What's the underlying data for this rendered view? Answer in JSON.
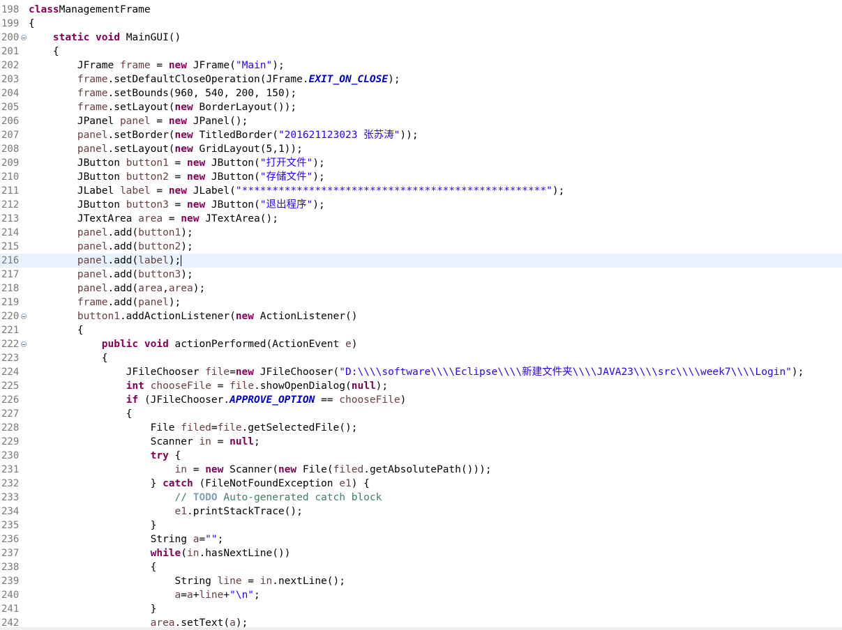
{
  "editor": {
    "lines": [
      {
        "n": "198",
        "t": [
          [
            "kw",
            "class"
          ],
          [
            "",
            "ManagementFrame"
          ]
        ]
      },
      {
        "n": "199",
        "t": [
          [
            "",
            "{"
          ]
        ]
      },
      {
        "n": "200",
        "fold": true,
        "t": [
          [
            "",
            "    "
          ],
          [
            "kw",
            "static"
          ],
          [
            "",
            " "
          ],
          [
            "kw",
            "void"
          ],
          [
            "",
            " MainGUI()"
          ]
        ]
      },
      {
        "n": "201",
        "t": [
          [
            "",
            "    {"
          ]
        ]
      },
      {
        "n": "202",
        "t": [
          [
            "",
            "        JFrame "
          ],
          [
            "var",
            "frame"
          ],
          [
            "",
            " = "
          ],
          [
            "kw",
            "new"
          ],
          [
            "",
            " JFrame("
          ],
          [
            "str",
            "\"Main\""
          ],
          [
            "",
            ");"
          ]
        ]
      },
      {
        "n": "203",
        "t": [
          [
            "",
            "        "
          ],
          [
            "var",
            "frame"
          ],
          [
            "",
            ".setDefaultCloseOperation(JFrame."
          ],
          [
            "fld",
            "EXIT_ON_CLOSE"
          ],
          [
            "",
            ");"
          ]
        ]
      },
      {
        "n": "204",
        "t": [
          [
            "",
            "        "
          ],
          [
            "var",
            "frame"
          ],
          [
            "",
            ".setBounds(960, 540, 200, 150);"
          ]
        ]
      },
      {
        "n": "205",
        "t": [
          [
            "",
            "        "
          ],
          [
            "var",
            "frame"
          ],
          [
            "",
            ".setLayout("
          ],
          [
            "kw",
            "new"
          ],
          [
            "",
            " BorderLayout());"
          ]
        ]
      },
      {
        "n": "206",
        "t": [
          [
            "",
            "        JPanel "
          ],
          [
            "var",
            "panel"
          ],
          [
            "",
            " = "
          ],
          [
            "kw",
            "new"
          ],
          [
            "",
            " JPanel();"
          ]
        ]
      },
      {
        "n": "207",
        "t": [
          [
            "",
            "        "
          ],
          [
            "var",
            "panel"
          ],
          [
            "",
            ".setBorder("
          ],
          [
            "kw",
            "new"
          ],
          [
            "",
            " TitledBorder("
          ],
          [
            "str",
            "\"201621123023 张苏涛\""
          ],
          [
            "",
            "));"
          ]
        ]
      },
      {
        "n": "208",
        "t": [
          [
            "",
            "        "
          ],
          [
            "var",
            "panel"
          ],
          [
            "",
            ".setLayout("
          ],
          [
            "kw",
            "new"
          ],
          [
            "",
            " GridLayout(5,1));"
          ]
        ]
      },
      {
        "n": "209",
        "t": [
          [
            "",
            "        JButton "
          ],
          [
            "var",
            "button1"
          ],
          [
            "",
            " = "
          ],
          [
            "kw",
            "new"
          ],
          [
            "",
            " JButton("
          ],
          [
            "str",
            "\"打开文件\""
          ],
          [
            "",
            ");"
          ]
        ]
      },
      {
        "n": "210",
        "t": [
          [
            "",
            "        JButton "
          ],
          [
            "var",
            "button2"
          ],
          [
            "",
            " = "
          ],
          [
            "kw",
            "new"
          ],
          [
            "",
            " JButton("
          ],
          [
            "str",
            "\"存储文件\""
          ],
          [
            "",
            ");"
          ]
        ]
      },
      {
        "n": "211",
        "t": [
          [
            "",
            "        JLabel "
          ],
          [
            "var",
            "label"
          ],
          [
            "",
            " = "
          ],
          [
            "kw",
            "new"
          ],
          [
            "",
            " JLabel("
          ],
          [
            "str",
            "\"**************************************************\""
          ],
          [
            "",
            ");"
          ]
        ]
      },
      {
        "n": "212",
        "t": [
          [
            "",
            "        JButton "
          ],
          [
            "var",
            "button3"
          ],
          [
            "",
            " = "
          ],
          [
            "kw",
            "new"
          ],
          [
            "",
            " JButton("
          ],
          [
            "str",
            "\"退出程序\""
          ],
          [
            "",
            ");"
          ]
        ]
      },
      {
        "n": "213",
        "t": [
          [
            "",
            "        JTextArea "
          ],
          [
            "var",
            "area"
          ],
          [
            "",
            " = "
          ],
          [
            "kw",
            "new"
          ],
          [
            "",
            " JTextArea();"
          ]
        ]
      },
      {
        "n": "214",
        "t": [
          [
            "",
            "        "
          ],
          [
            "var",
            "panel"
          ],
          [
            "",
            ".add("
          ],
          [
            "var",
            "button1"
          ],
          [
            "",
            ");"
          ]
        ]
      },
      {
        "n": "215",
        "t": [
          [
            "",
            "        "
          ],
          [
            "var",
            "panel"
          ],
          [
            "",
            ".add("
          ],
          [
            "var",
            "button2"
          ],
          [
            "",
            ");"
          ]
        ]
      },
      {
        "n": "216",
        "current": true,
        "t": [
          [
            "",
            "        "
          ],
          [
            "var",
            "panel"
          ],
          [
            "",
            ".add("
          ],
          [
            "var",
            "label"
          ],
          [
            "",
            ");"
          ]
        ]
      },
      {
        "n": "217",
        "t": [
          [
            "",
            "        "
          ],
          [
            "var",
            "panel"
          ],
          [
            "",
            ".add("
          ],
          [
            "var",
            "button3"
          ],
          [
            "",
            ");"
          ]
        ]
      },
      {
        "n": "218",
        "t": [
          [
            "",
            "        "
          ],
          [
            "var",
            "panel"
          ],
          [
            "",
            ".add("
          ],
          [
            "var",
            "area"
          ],
          [
            "",
            ","
          ],
          [
            "var",
            "area"
          ],
          [
            "",
            ");"
          ]
        ]
      },
      {
        "n": "219",
        "t": [
          [
            "",
            "        "
          ],
          [
            "var",
            "frame"
          ],
          [
            "",
            ".add("
          ],
          [
            "var",
            "panel"
          ],
          [
            "",
            ");"
          ]
        ]
      },
      {
        "n": "220",
        "fold": true,
        "t": [
          [
            "",
            "        "
          ],
          [
            "var",
            "button1"
          ],
          [
            "",
            ".addActionListener("
          ],
          [
            "kw",
            "new"
          ],
          [
            "",
            " ActionListener()"
          ]
        ]
      },
      {
        "n": "221",
        "t": [
          [
            "",
            "        {"
          ]
        ]
      },
      {
        "n": "222",
        "fold": true,
        "t": [
          [
            "",
            "            "
          ],
          [
            "kw",
            "public"
          ],
          [
            "",
            " "
          ],
          [
            "kw",
            "void"
          ],
          [
            "",
            " actionPerformed(ActionEvent "
          ],
          [
            "var",
            "e"
          ],
          [
            "",
            ")"
          ]
        ]
      },
      {
        "n": "223",
        "t": [
          [
            "",
            "            {"
          ]
        ]
      },
      {
        "n": "224",
        "t": [
          [
            "",
            "                JFileChooser "
          ],
          [
            "var",
            "file"
          ],
          [
            "",
            "="
          ],
          [
            "kw",
            "new"
          ],
          [
            "",
            " JFileChooser("
          ],
          [
            "str",
            "\"D:\\\\\\\\software\\\\\\\\Eclipse\\\\\\\\新建文件夹\\\\\\\\JAVA23\\\\\\\\src\\\\\\\\week7\\\\\\\\Login\""
          ],
          [
            "",
            ");"
          ]
        ]
      },
      {
        "n": "225",
        "t": [
          [
            "",
            "                "
          ],
          [
            "kw",
            "int"
          ],
          [
            "",
            " "
          ],
          [
            "var",
            "chooseFile"
          ],
          [
            "",
            " = "
          ],
          [
            "var",
            "file"
          ],
          [
            "",
            ".showOpenDialog("
          ],
          [
            "kw",
            "null"
          ],
          [
            "",
            ");"
          ]
        ]
      },
      {
        "n": "226",
        "t": [
          [
            "",
            "                "
          ],
          [
            "kw",
            "if"
          ],
          [
            "",
            " (JFileChooser."
          ],
          [
            "fld",
            "APPROVE_OPTION"
          ],
          [
            "",
            " == "
          ],
          [
            "var",
            "chooseFile"
          ],
          [
            "",
            ")"
          ]
        ]
      },
      {
        "n": "227",
        "t": [
          [
            "",
            "                {"
          ]
        ]
      },
      {
        "n": "228",
        "t": [
          [
            "",
            "                    File "
          ],
          [
            "var",
            "filed"
          ],
          [
            "",
            "="
          ],
          [
            "var",
            "file"
          ],
          [
            "",
            ".getSelectedFile();"
          ]
        ]
      },
      {
        "n": "229",
        "t": [
          [
            "",
            "                    Scanner "
          ],
          [
            "var",
            "in"
          ],
          [
            "",
            " = "
          ],
          [
            "kw",
            "null"
          ],
          [
            "",
            ";"
          ]
        ]
      },
      {
        "n": "230",
        "t": [
          [
            "",
            "                    "
          ],
          [
            "kw",
            "try"
          ],
          [
            "",
            " {"
          ]
        ]
      },
      {
        "n": "231",
        "t": [
          [
            "",
            "                        "
          ],
          [
            "var",
            "in"
          ],
          [
            "",
            " = "
          ],
          [
            "kw",
            "new"
          ],
          [
            "",
            " Scanner("
          ],
          [
            "kw",
            "new"
          ],
          [
            "",
            " File("
          ],
          [
            "var",
            "filed"
          ],
          [
            "",
            ".getAbsolutePath()));"
          ]
        ]
      },
      {
        "n": "232",
        "t": [
          [
            "",
            "                    } "
          ],
          [
            "kw",
            "catch"
          ],
          [
            "",
            " (FileNotFoundException "
          ],
          [
            "var",
            "e1"
          ],
          [
            "",
            ") {"
          ]
        ]
      },
      {
        "n": "233",
        "t": [
          [
            "",
            "                        "
          ],
          [
            "cm",
            "// "
          ],
          [
            "todo",
            "TODO"
          ],
          [
            "cm",
            " Auto-generated catch block"
          ]
        ]
      },
      {
        "n": "234",
        "t": [
          [
            "",
            "                        "
          ],
          [
            "var",
            "e1"
          ],
          [
            "",
            ".printStackTrace();"
          ]
        ]
      },
      {
        "n": "235",
        "t": [
          [
            "",
            "                    }"
          ]
        ]
      },
      {
        "n": "236",
        "t": [
          [
            "",
            "                    String "
          ],
          [
            "var",
            "a"
          ],
          [
            "",
            "="
          ],
          [
            "str",
            "\"\""
          ],
          [
            "",
            ";"
          ]
        ]
      },
      {
        "n": "237",
        "t": [
          [
            "",
            "                    "
          ],
          [
            "kw",
            "while"
          ],
          [
            "",
            "("
          ],
          [
            "var",
            "in"
          ],
          [
            "",
            ".hasNextLine())"
          ]
        ]
      },
      {
        "n": "238",
        "t": [
          [
            "",
            "                    {"
          ]
        ]
      },
      {
        "n": "239",
        "t": [
          [
            "",
            "                        String "
          ],
          [
            "var",
            "line"
          ],
          [
            "",
            " = "
          ],
          [
            "var",
            "in"
          ],
          [
            "",
            ".nextLine();"
          ]
        ]
      },
      {
        "n": "240",
        "t": [
          [
            "",
            "                        "
          ],
          [
            "var",
            "a"
          ],
          [
            "",
            "="
          ],
          [
            "var",
            "a"
          ],
          [
            "",
            "+"
          ],
          [
            "var",
            "line"
          ],
          [
            "",
            "+"
          ],
          [
            "str",
            "\"\\n\""
          ],
          [
            "",
            ";"
          ]
        ]
      },
      {
        "n": "241",
        "t": [
          [
            "",
            "                    }"
          ]
        ]
      },
      {
        "n": "242",
        "t": [
          [
            "",
            "                    "
          ],
          [
            "var",
            "area"
          ],
          [
            "",
            ".setText("
          ],
          [
            "var",
            "a"
          ],
          [
            "",
            ");"
          ]
        ]
      }
    ]
  }
}
